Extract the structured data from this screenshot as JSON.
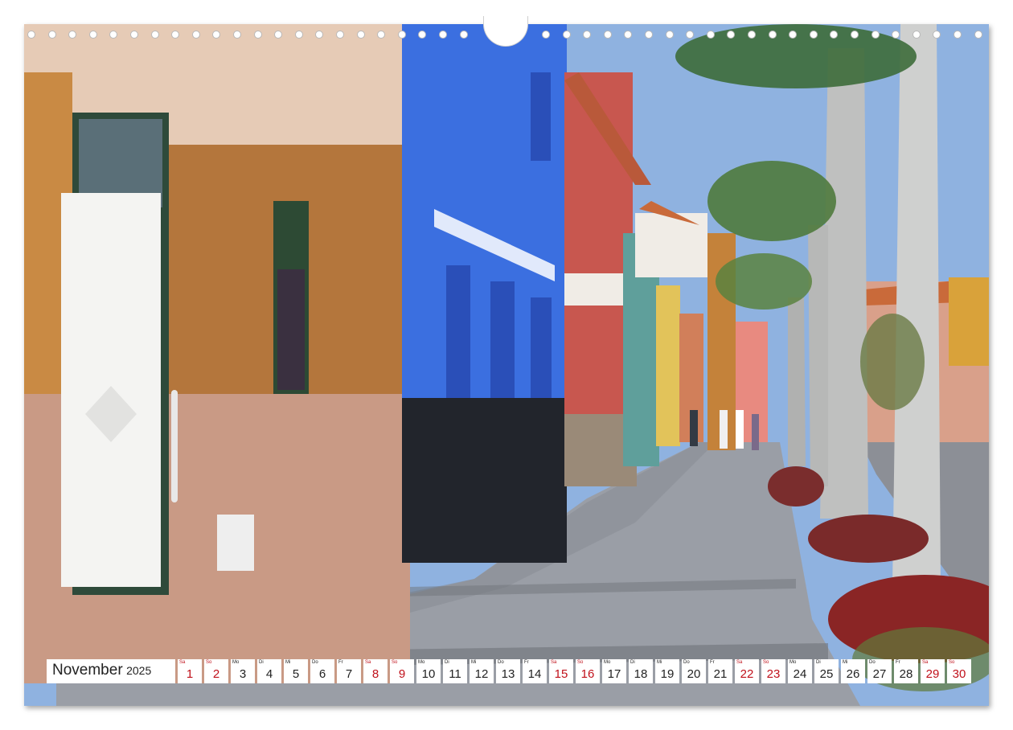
{
  "calendar": {
    "month": "November",
    "year": "2025",
    "days": [
      {
        "wd": "Sa",
        "n": "1",
        "weekend": true
      },
      {
        "wd": "So",
        "n": "2",
        "weekend": true
      },
      {
        "wd": "Mo",
        "n": "3",
        "weekend": false
      },
      {
        "wd": "Di",
        "n": "4",
        "weekend": false
      },
      {
        "wd": "Mi",
        "n": "5",
        "weekend": false
      },
      {
        "wd": "Do",
        "n": "6",
        "weekend": false
      },
      {
        "wd": "Fr",
        "n": "7",
        "weekend": false
      },
      {
        "wd": "Sa",
        "n": "8",
        "weekend": true
      },
      {
        "wd": "So",
        "n": "9",
        "weekend": true
      },
      {
        "wd": "Mo",
        "n": "10",
        "weekend": false
      },
      {
        "wd": "Di",
        "n": "11",
        "weekend": false
      },
      {
        "wd": "Mi",
        "n": "12",
        "weekend": false
      },
      {
        "wd": "Do",
        "n": "13",
        "weekend": false
      },
      {
        "wd": "Fr",
        "n": "14",
        "weekend": false
      },
      {
        "wd": "Sa",
        "n": "15",
        "weekend": true
      },
      {
        "wd": "So",
        "n": "16",
        "weekend": true
      },
      {
        "wd": "Mo",
        "n": "17",
        "weekend": false
      },
      {
        "wd": "Di",
        "n": "18",
        "weekend": false
      },
      {
        "wd": "Mi",
        "n": "19",
        "weekend": false
      },
      {
        "wd": "Do",
        "n": "20",
        "weekend": false
      },
      {
        "wd": "Fr",
        "n": "21",
        "weekend": false
      },
      {
        "wd": "Sa",
        "n": "22",
        "weekend": true
      },
      {
        "wd": "So",
        "n": "23",
        "weekend": true
      },
      {
        "wd": "Mo",
        "n": "24",
        "weekend": false
      },
      {
        "wd": "Di",
        "n": "25",
        "weekend": false
      },
      {
        "wd": "Mi",
        "n": "26",
        "weekend": false
      },
      {
        "wd": "Do",
        "n": "27",
        "weekend": false
      },
      {
        "wd": "Fr",
        "n": "28",
        "weekend": false
      },
      {
        "wd": "Sa",
        "n": "29",
        "weekend": true
      },
      {
        "wd": "So",
        "n": "30",
        "weekend": true
      }
    ]
  },
  "colors": {
    "weekend": "#c0101a",
    "sky": "#8fb2e0",
    "blue_house": "#3b6fe0",
    "red_house": "#c8574f",
    "brick": "#b4763c"
  }
}
